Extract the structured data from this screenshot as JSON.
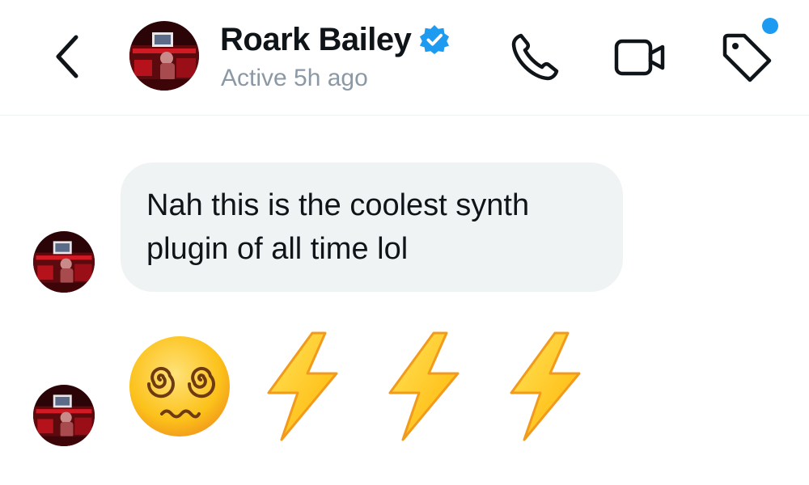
{
  "header": {
    "contact_name": "Roark Bailey",
    "status": "Active 5h ago",
    "back_icon": "chevron-left-icon",
    "verified_icon": "verified-badge-icon",
    "actions": [
      {
        "name": "call",
        "icon": "phone-icon"
      },
      {
        "name": "video",
        "icon": "video-camera-icon"
      },
      {
        "name": "label",
        "icon": "tag-icon"
      }
    ],
    "notification_dot": true
  },
  "messages": [
    {
      "type": "text",
      "text": "Nah this is the coolest synth plugin of all time lol"
    },
    {
      "type": "emoji",
      "emojis": [
        "face-with-spiral-eyes",
        "high-voltage",
        "high-voltage",
        "high-voltage"
      ]
    }
  ],
  "colors": {
    "accent": "#1d9bf0",
    "bubble_bg": "#eff3f4",
    "text": "#0f1419",
    "muted": "#8b98a5",
    "emoji_yellow": "#fcc21b",
    "bolt_yellow": "#ffd21a"
  }
}
